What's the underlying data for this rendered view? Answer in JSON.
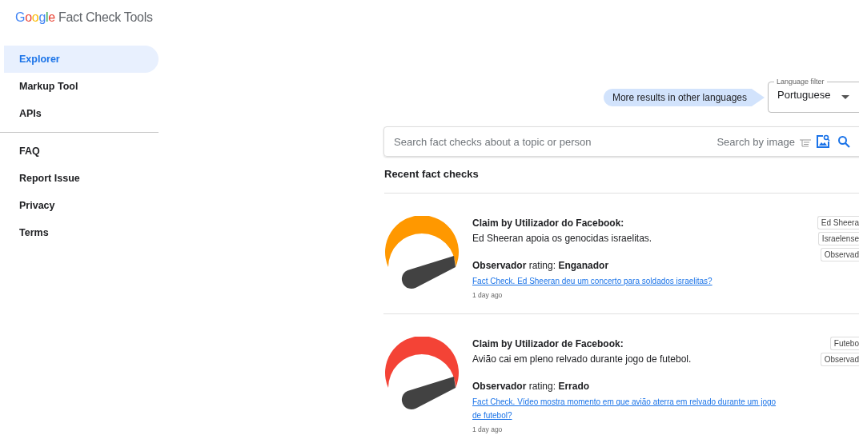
{
  "logo": {
    "brand": "Google",
    "product": "Fact Check Tools"
  },
  "sidebar": {
    "groups": [
      [
        {
          "label": "Explorer",
          "selected": true
        },
        {
          "label": "Markup Tool",
          "selected": false
        },
        {
          "label": "APIs",
          "selected": false
        }
      ],
      [
        {
          "label": "FAQ",
          "selected": false
        },
        {
          "label": "Report Issue",
          "selected": false
        },
        {
          "label": "Privacy",
          "selected": false
        },
        {
          "label": "Terms",
          "selected": false
        }
      ]
    ]
  },
  "language_hint": "More results in other languages",
  "language_filter": {
    "label": "Language filter",
    "value": "Portuguese"
  },
  "search": {
    "placeholder": "Search fact checks about a topic or person",
    "image_search_label": "Search by image"
  },
  "section_title": "Recent fact checks",
  "fact_checks": [
    {
      "claimant": "Claim by Utilizador do Facebook:",
      "claim": "Ed Sheeran apoia os genocidas israelitas.",
      "rating": "**Observador** rating: **Enganador**",
      "link": "Fact Check. Ed Sheeran deu um concerto para soldados israelitas?",
      "time": "1 day ago",
      "color": "#ff9800",
      "tags": [
        "Ed Sheera",
        "Israelense",
        "Observad"
      ]
    },
    {
      "claimant": "Claim by Utilizador de Facebook:",
      "claim": "Avião cai em pleno relvado durante jogo de futebol.",
      "rating": "**Observador** rating: **Errado**",
      "link": "Fact Check. Vídeo mostra momento em que avião aterra em relvado durante um jogo de futebol?",
      "time": "1 day ago",
      "color": "#f44336",
      "tags": [
        "Futebo",
        "Observad"
      ]
    }
  ]
}
